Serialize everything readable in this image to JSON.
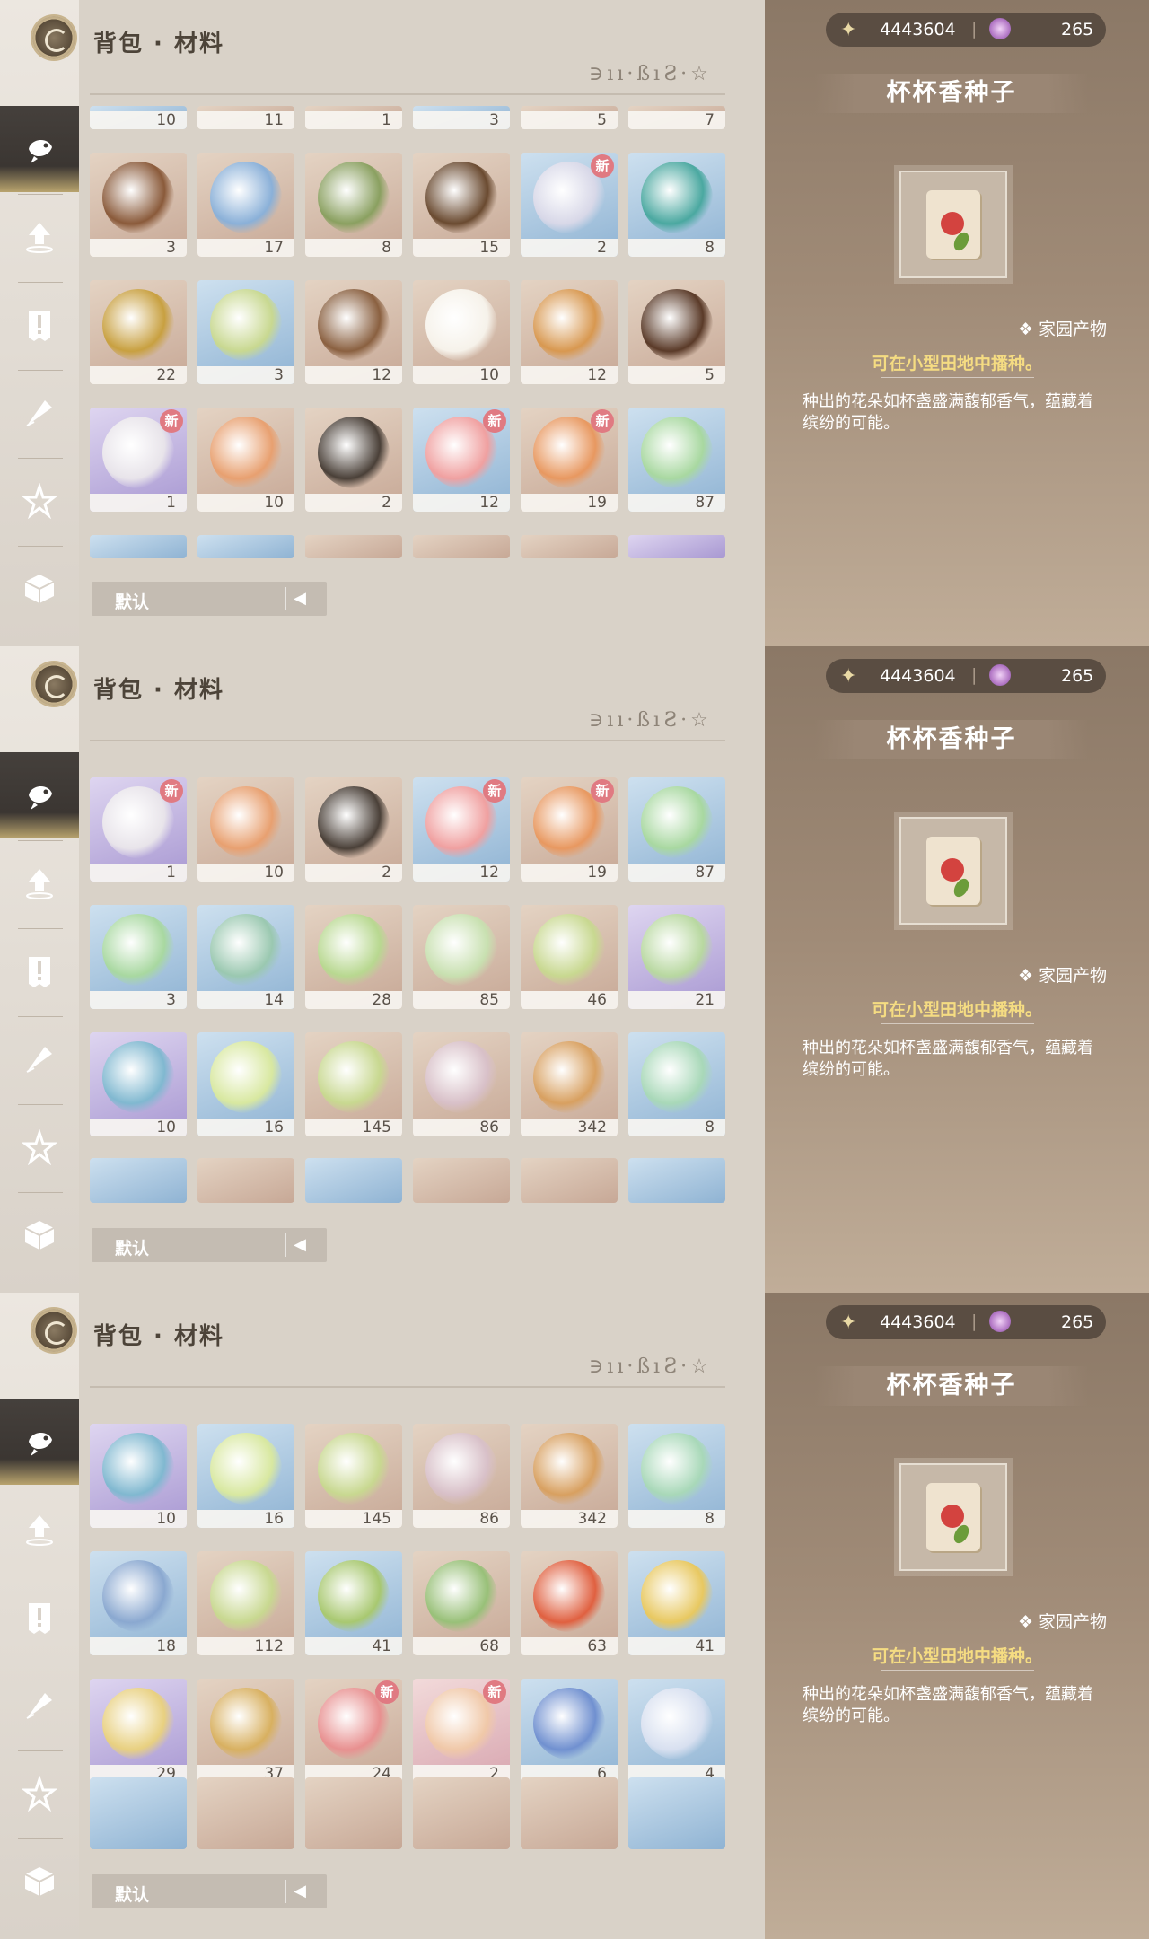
{
  "title": "背包 · 材料",
  "deco_text": "∋ıı·ßıƧ·☆",
  "sort": {
    "label": "默认",
    "toggle": "◀▶"
  },
  "currency": {
    "stars": "4443604",
    "gems": "265"
  },
  "detail": {
    "name": "杯杯香种子",
    "tag": "家园产物",
    "hint": "可在小型田地中播种。",
    "description": "种出的花朵如杯盏盛满馥郁香气，蕴藏着缤纷的可能。"
  },
  "sidebar": [
    "fish-icon",
    "upload-icon",
    "alert-icon",
    "quill-icon",
    "star-icon",
    "box-icon"
  ],
  "panels": [
    {
      "rows": [
        {
          "partial": true,
          "items": [
            {
              "count": "10",
              "rarity": "blue"
            },
            {
              "count": "11",
              "rarity": "tan"
            },
            {
              "count": "1",
              "rarity": "tan"
            },
            {
              "count": "3",
              "rarity": "blue"
            },
            {
              "count": "5",
              "rarity": "tan"
            },
            {
              "count": "7",
              "rarity": "tan"
            }
          ]
        },
        {
          "items": [
            {
              "count": "3",
              "rarity": "tan",
              "color": "#8a5a3a"
            },
            {
              "count": "17",
              "rarity": "tan",
              "color": "#8ab0d8"
            },
            {
              "count": "8",
              "rarity": "tan",
              "color": "#8aa060"
            },
            {
              "count": "15",
              "rarity": "tan",
              "color": "#6a4a30"
            },
            {
              "count": "2",
              "rarity": "blue",
              "color": "#d8d8e8",
              "new": true
            },
            {
              "count": "8",
              "rarity": "blue",
              "color": "#4aa8a0"
            }
          ]
        },
        {
          "items": [
            {
              "count": "22",
              "rarity": "tan",
              "color": "#c8a040"
            },
            {
              "count": "3",
              "rarity": "blue",
              "color": "#c8d890"
            },
            {
              "count": "12",
              "rarity": "tan",
              "color": "#8a6040"
            },
            {
              "count": "10",
              "rarity": "tan",
              "color": "#f6f2ea"
            },
            {
              "count": "12",
              "rarity": "tan",
              "color": "#d89850"
            },
            {
              "count": "5",
              "rarity": "tan",
              "color": "#5a3a28"
            }
          ]
        },
        {
          "items": [
            {
              "count": "1",
              "rarity": "purple",
              "color": "#e8e4ea",
              "new": true
            },
            {
              "count": "10",
              "rarity": "tan",
              "color": "#e8a070"
            },
            {
              "count": "2",
              "rarity": "tan",
              "color": "#4a4038"
            },
            {
              "count": "12",
              "rarity": "blue",
              "color": "#f0a0a0",
              "new": true
            },
            {
              "count": "19",
              "rarity": "tan",
              "color": "#e89860",
              "new": true
            },
            {
              "count": "87",
              "rarity": "blue",
              "color": "#a8d8a0"
            }
          ]
        },
        {
          "partial": true,
          "items": [
            {
              "count": "",
              "rarity": "blue"
            },
            {
              "count": "",
              "rarity": "blue"
            },
            {
              "count": "",
              "rarity": "tan"
            },
            {
              "count": "",
              "rarity": "tan"
            },
            {
              "count": "",
              "rarity": "tan"
            },
            {
              "count": "",
              "rarity": "purple"
            }
          ]
        }
      ]
    },
    {
      "rows": [
        {
          "items": [
            {
              "count": "1",
              "rarity": "purple",
              "color": "#e8e4ea",
              "new": true
            },
            {
              "count": "10",
              "rarity": "tan",
              "color": "#e8a070"
            },
            {
              "count": "2",
              "rarity": "tan",
              "color": "#4a4038"
            },
            {
              "count": "12",
              "rarity": "blue",
              "color": "#f0a0a0",
              "new": true
            },
            {
              "count": "19",
              "rarity": "tan",
              "color": "#e89860",
              "new": true
            },
            {
              "count": "87",
              "rarity": "blue",
              "color": "#a8d8a0"
            }
          ]
        },
        {
          "items": [
            {
              "count": "3",
              "rarity": "blue",
              "color": "#a8d8a0"
            },
            {
              "count": "14",
              "rarity": "blue",
              "color": "#9ac8b0"
            },
            {
              "count": "28",
              "rarity": "tan",
              "color": "#b8d890"
            },
            {
              "count": "85",
              "rarity": "tan",
              "color": "#c8e0b0"
            },
            {
              "count": "46",
              "rarity": "tan",
              "color": "#c8d890"
            },
            {
              "count": "21",
              "rarity": "purple",
              "color": "#b8d8a0"
            }
          ]
        },
        {
          "items": [
            {
              "count": "10",
              "rarity": "purple",
              "color": "#80b8d0"
            },
            {
              "count": "16",
              "rarity": "blue",
              "color": "#d8e8a0"
            },
            {
              "count": "145",
              "rarity": "tan",
              "color": "#c8d890"
            },
            {
              "count": "86",
              "rarity": "tan",
              "color": "#d8c0c8"
            },
            {
              "count": "342",
              "rarity": "tan",
              "color": "#d8a060"
            },
            {
              "count": "8",
              "rarity": "blue",
              "color": "#a8d8b8"
            }
          ]
        },
        {
          "partial": true,
          "items": [
            {
              "count": "",
              "rarity": "blue"
            },
            {
              "count": "",
              "rarity": "tan"
            },
            {
              "count": "",
              "rarity": "blue"
            },
            {
              "count": "",
              "rarity": "tan"
            },
            {
              "count": "",
              "rarity": "tan"
            },
            {
              "count": "",
              "rarity": "blue"
            }
          ]
        }
      ]
    },
    {
      "rows": [
        {
          "items": [
            {
              "count": "10",
              "rarity": "purple",
              "color": "#80b8d0"
            },
            {
              "count": "16",
              "rarity": "blue",
              "color": "#d8e8a0"
            },
            {
              "count": "145",
              "rarity": "tan",
              "color": "#c8d890"
            },
            {
              "count": "86",
              "rarity": "tan",
              "color": "#d8c0c8"
            },
            {
              "count": "342",
              "rarity": "tan",
              "color": "#d8a060"
            },
            {
              "count": "8",
              "rarity": "blue",
              "color": "#a8d8b8"
            }
          ]
        },
        {
          "items": [
            {
              "count": "18",
              "rarity": "blue",
              "color": "#8aa8d0"
            },
            {
              "count": "112",
              "rarity": "tan",
              "color": "#c8d890"
            },
            {
              "count": "41",
              "rarity": "blue",
              "color": "#a8c870"
            },
            {
              "count": "68",
              "rarity": "tan",
              "color": "#98c078"
            },
            {
              "count": "63",
              "rarity": "tan",
              "color": "#e06040"
            },
            {
              "count": "41",
              "rarity": "blue",
              "color": "#e8c860"
            }
          ]
        },
        {
          "items": [
            {
              "count": "29",
              "rarity": "purple",
              "color": "#e8d080"
            },
            {
              "count": "37",
              "rarity": "tan",
              "color": "#d8b060"
            },
            {
              "count": "24",
              "rarity": "tan",
              "color": "#e89090",
              "new": true
            },
            {
              "count": "2",
              "rarity": "pink",
              "color": "#f0c8a8",
              "new": true
            },
            {
              "count": "6",
              "rarity": "blue",
              "color": "#7090d0"
            },
            {
              "count": "4",
              "rarity": "blue",
              "color": "#d8e0f0"
            }
          ]
        },
        {
          "partial": true,
          "items": [
            {
              "count": "",
              "rarity": "blue"
            },
            {
              "count": "",
              "rarity": "tan"
            },
            {
              "count": "",
              "rarity": "tan"
            },
            {
              "count": "",
              "rarity": "tan"
            },
            {
              "count": "",
              "rarity": "tan"
            },
            {
              "count": "",
              "rarity": "blue"
            }
          ]
        }
      ]
    }
  ]
}
